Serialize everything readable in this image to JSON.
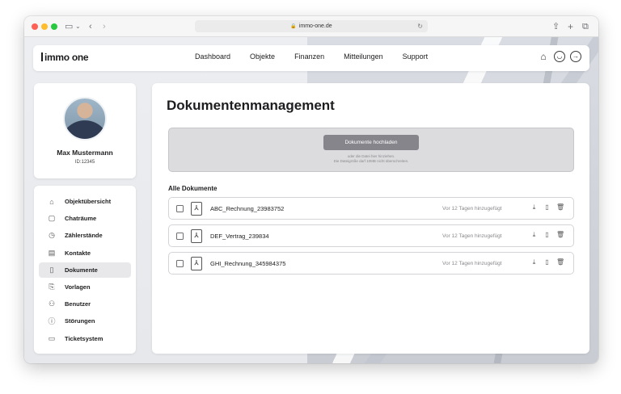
{
  "browser": {
    "url": "immo-one.de"
  },
  "brand": {
    "logo_text": "immo one"
  },
  "nav": {
    "items": [
      "Dashboard",
      "Objekte",
      "Finanzen",
      "Mitteilungen",
      "Support"
    ],
    "icons": [
      "home-icon",
      "user-icon",
      "logout-icon"
    ]
  },
  "profile": {
    "name": "Max Mustermann",
    "id": "ID:12345"
  },
  "sidebar": {
    "items": [
      {
        "label": "Objektübersicht",
        "icon": "house-icon"
      },
      {
        "label": "Chaträume",
        "icon": "chat-icon"
      },
      {
        "label": "Zählerstände",
        "icon": "meter-icon"
      },
      {
        "label": "Kontakte",
        "icon": "contacts-icon"
      },
      {
        "label": "Dokumente",
        "icon": "document-icon",
        "active": true
      },
      {
        "label": "Vorlagen",
        "icon": "template-icon"
      },
      {
        "label": "Benutzer",
        "icon": "users-icon"
      },
      {
        "label": "Störungen",
        "icon": "alert-icon"
      },
      {
        "label": "Ticketsystem",
        "icon": "ticket-icon"
      }
    ]
  },
  "main": {
    "title": "Dokumentenmanagement",
    "upload": {
      "button_label": "Dokumente hochladen",
      "hint_line1": "oder die Datei hier hinziehen.",
      "hint_line2": "Die Dateigröße darf 10MB nicht überschreiten."
    },
    "section_title": "Alle Dokumente",
    "documents": [
      {
        "name": "ABC_Rechnung_23983752",
        "added": "Vor 12 Tagen hinzugefügt"
      },
      {
        "name": "DEF_Vertrag_239834",
        "added": "Vor 12 Tagen hinzugefügt"
      },
      {
        "name": "GHI_Rechnung_345984375",
        "added": "Vor 12 Tagen hinzugefügt"
      }
    ]
  },
  "colors": {
    "accent_button": "#85858b",
    "active_sidebar": "#e8e8ea"
  }
}
